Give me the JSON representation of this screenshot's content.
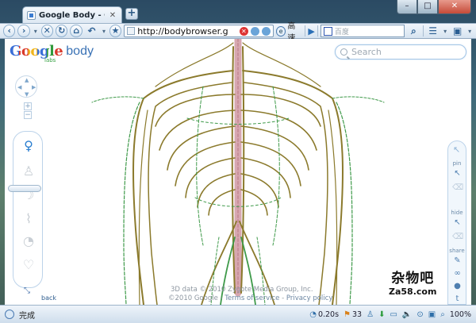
{
  "browser": {
    "tab_title": "Google Body - Google...",
    "tab_close": "✕",
    "new_tab": "+",
    "window_buttons": {
      "minimize": "–",
      "maximize": "□",
      "close": "✕"
    }
  },
  "toolbar": {
    "address": "http://bodybrowser.g",
    "speed_label": "高速",
    "search_placeholder": "百度"
  },
  "app": {
    "logo": "Google",
    "logo_sub": "labs",
    "product": "body",
    "search_placeholder": "Search",
    "zoom_in": "+",
    "zoom_out": "−",
    "back_label": "back",
    "right_tools": {
      "pin_label": "pin",
      "hide_label": "hide",
      "share_label": "share"
    },
    "footer_line1": "3D data © 2010 Zygote Media Group, Inc.",
    "footer_line2_prefix": "©2010 Google",
    "footer_terms": "Terms of service",
    "footer_privacy": "Privacy policy"
  },
  "watermark": {
    "cn": "杂物吧",
    "url": "Za58.com"
  },
  "statusbar": {
    "status": "完成",
    "speed": "0.20s",
    "count": "33",
    "zoom": "100%"
  },
  "colors": {
    "accent": "#3a72b5",
    "nerve": "#8b7a2c",
    "vessel": "#3f9a4a",
    "spine": "#d7a7b0"
  }
}
